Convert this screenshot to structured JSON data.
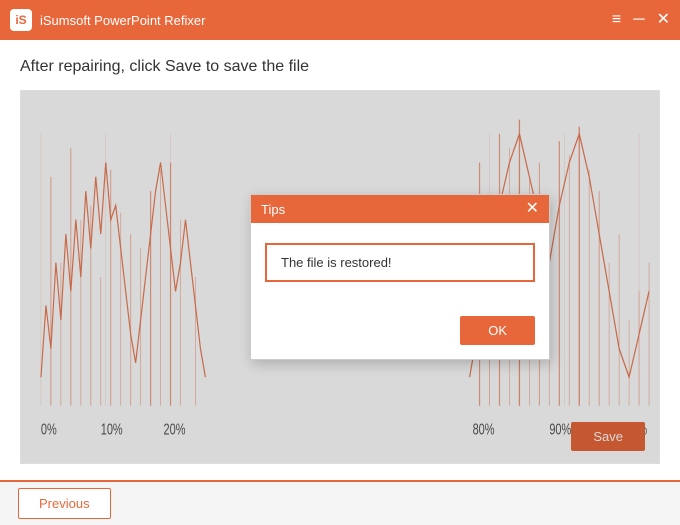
{
  "titleBar": {
    "appName": "iSumsoft PowerPoint Refixer",
    "controls": {
      "menu": "≡",
      "minimize": "─",
      "close": "✕"
    }
  },
  "main": {
    "instruction": "After repairing, click Save to save the file",
    "saveButton": "Save",
    "chart": {
      "xLabels": [
        "0%",
        "10%",
        "20%",
        "80%",
        "90%",
        "100%"
      ]
    }
  },
  "dialog": {
    "title": "Tips",
    "message": "The file is restored!",
    "okButton": "OK",
    "closeIcon": "✕"
  },
  "footer": {
    "previousButton": "Previous"
  }
}
